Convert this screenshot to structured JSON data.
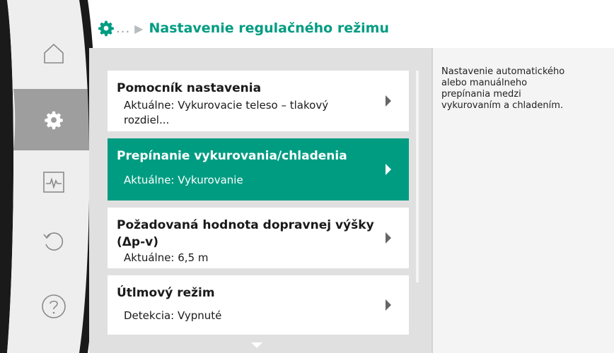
{
  "header": {
    "dots": "...",
    "arrow": "▶",
    "title": "Nastavenie regulačného režimu",
    "gear_icon": "gear-icon"
  },
  "sidebar": {
    "items": [
      {
        "name": "home",
        "icon": "home-icon",
        "active": false
      },
      {
        "name": "settings",
        "icon": "gear-icon",
        "active": true
      },
      {
        "name": "diagnostics",
        "icon": "pulse-icon",
        "active": false
      },
      {
        "name": "restore",
        "icon": "undo-icon",
        "active": false
      },
      {
        "name": "help",
        "icon": "help-icon",
        "active": false
      }
    ]
  },
  "menu": {
    "items": [
      {
        "title": "Pomocník nastavenia",
        "subtitle": "Aktuálne: Vykurovacie teleso – tlakový rozdiel...",
        "selected": false
      },
      {
        "title": "Prepínanie vykurovania/chladenia",
        "subtitle": "Aktuálne: Vykurovanie",
        "selected": true
      },
      {
        "title": "Požadovaná hodnota dopravnej výšky (Δp-v)",
        "subtitle": "Aktuálne: 6,5 m",
        "selected": false
      },
      {
        "title": "Útlmový režim",
        "subtitle": "Detekcia: Vypnuté",
        "selected": false
      }
    ]
  },
  "help": {
    "text": "Nastavenie automatického alebo manuálneho prepínania medzi vykurovaním a chladením."
  },
  "colors": {
    "accent": "#009c82",
    "content_bg": "#e0e0e0",
    "sidebar_bg": "#eeeeee",
    "sidebar_active": "#9e9e9e",
    "bezel": "#1a1a1a"
  }
}
